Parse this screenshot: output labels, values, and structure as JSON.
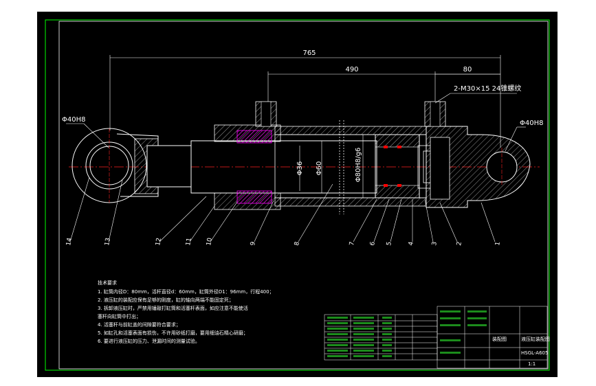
{
  "drawing": {
    "dimensions": {
      "overall_length": "765",
      "stroke_length": "490",
      "end_offset": "80",
      "port_thread": "2-M30×15 24锥螺纹",
      "left_pin": "Φ40H8",
      "right_pin": "Φ40H8",
      "rod_dia": "Φ36",
      "bore_inner": "Φ60",
      "piston_fit": "Φ80H8/g6"
    },
    "balloons": [
      "1",
      "2",
      "3",
      "4",
      "5",
      "6",
      "7",
      "8",
      "9",
      "10",
      "11",
      "12",
      "13",
      "14"
    ],
    "tech_notes": {
      "title": "技术要求",
      "items": [
        "1. 缸筒内径D：80mm，活杆直径d：60mm，缸筒外径D1：96mm，行程400；",
        "2. 液压缸的装配应保有足够的刚度，缸的轴向两端不能固定死；",
        "3. 拆卸液压缸时，严禁用锤敲打缸筒和活塞杆表面，如应注意不能使活",
        "   塞杆向缸筒中打出；",
        "4. 活塞杆与前缸盖的间隙要符合要求；",
        "5. 如缸孔和活塞表面有损伤，不许用砂纸打磨，要用细油石精心研磨；",
        "6. 要进行液压缸的压力、泄漏时间的测量试验。"
      ]
    },
    "title_block": {
      "drawing_name": "液压缸装配图",
      "drawing_number": "HSGL-A605",
      "scale": "1:1",
      "material": "装配图"
    },
    "colors": {
      "background": "#000000",
      "border": "#00ff00",
      "outline": "#ffffff",
      "centerline": "#ff2020",
      "hatch": "#ff00ff",
      "dimension": "#ffffff",
      "leader": "#ffffff",
      "seal": "#ff0000"
    }
  }
}
